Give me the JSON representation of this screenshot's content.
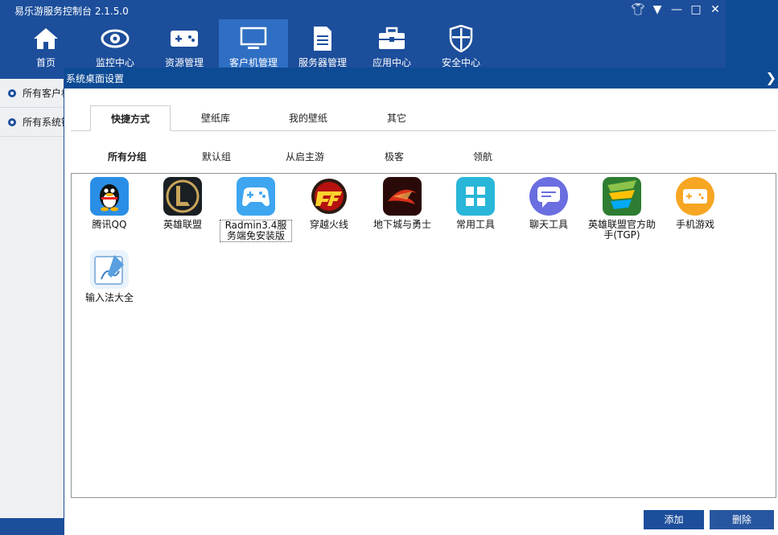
{
  "app": {
    "title": "易乐游服务控制台 2.1.5.0"
  },
  "nav": [
    {
      "label": "首页",
      "icon": "home-icon"
    },
    {
      "label": "监控中心",
      "icon": "eye-icon"
    },
    {
      "label": "资源管理",
      "icon": "gamepad-icon"
    },
    {
      "label": "客户机管理",
      "icon": "monitor-icon"
    },
    {
      "label": "服务器管理",
      "icon": "server-icon"
    },
    {
      "label": "应用中心",
      "icon": "toolbox-icon"
    },
    {
      "label": "安全中心",
      "icon": "shield-icon"
    }
  ],
  "left_panel": {
    "items": [
      "所有客户机",
      "所有系统镜像"
    ]
  },
  "dialog": {
    "title": "系统桌面设置",
    "tabs": [
      "快捷方式",
      "壁纸库",
      "我的壁纸",
      "其它"
    ],
    "groups": [
      "所有分组",
      "默认组",
      "从启主游",
      "极客",
      "领航"
    ],
    "apps": [
      {
        "label": "腾讯QQ",
        "icon": "qq-icon"
      },
      {
        "label": "英雄联盟",
        "icon": "lol-icon"
      },
      {
        "label": "Radmin3.4服务端免安装版",
        "icon": "gamepad-app-icon"
      },
      {
        "label": "穿越火线",
        "icon": "crossfire-icon"
      },
      {
        "label": "地下城与勇士",
        "icon": "dnf-icon"
      },
      {
        "label": "常用工具",
        "icon": "tools-grid-icon"
      },
      {
        "label": "聊天工具",
        "icon": "chat-icon"
      },
      {
        "label": "英雄联盟官方助手(TGP)",
        "icon": "tgp-icon"
      },
      {
        "label": "手机游戏",
        "icon": "mobile-game-icon"
      },
      {
        "label": "输入法大全",
        "icon": "input-method-icon"
      }
    ],
    "buttons": {
      "add": "添加",
      "delete": "删除"
    }
  },
  "colors": {
    "chrome": "#1c4e9b",
    "nav_active": "#2f6fc3",
    "dialog_title": "#0e4b95"
  }
}
